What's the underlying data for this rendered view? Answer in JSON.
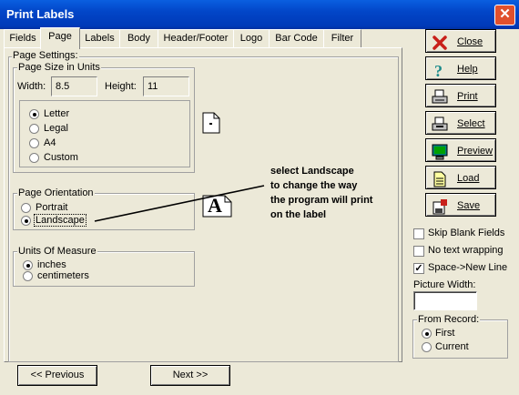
{
  "window": {
    "title": "Print Labels",
    "close_glyph": "✕"
  },
  "tabs": [
    "Fields",
    "Page",
    "Labels",
    "Body",
    "Header/Footer",
    "Logo",
    "Bar Code",
    "Filter"
  ],
  "page_settings": {
    "label": "Page Settings:",
    "size_group": {
      "label": "Page Size in Units",
      "width_label": "Width:",
      "width_value": "8.5",
      "height_label": "Height:",
      "height_value": "11",
      "options": [
        "Letter",
        "Legal",
        "A4",
        "Custom"
      ],
      "selected": "Letter"
    },
    "orientation_group": {
      "label": "Page Orientation",
      "options": [
        "Portrait",
        "Landscape"
      ],
      "selected": "Landscape"
    },
    "units_group": {
      "label": "Units Of Measure",
      "options": [
        "inches",
        "centimeters"
      ],
      "selected": "inches"
    },
    "orientation_icon_letter": "A"
  },
  "annotation": {
    "lines": [
      "select Landscape",
      "to change the way",
      "the program will print",
      "on the label"
    ]
  },
  "buttons": {
    "close": "Close",
    "help": "Help",
    "print": "Print",
    "select": "Select",
    "preview": "Preview",
    "load": "Load",
    "save": "Save"
  },
  "options": {
    "skip_blank": {
      "label": "Skip Blank Fields",
      "checked": false
    },
    "no_wrap": {
      "label": "No text wrapping",
      "checked": false
    },
    "space_newline": {
      "label": "Space->New Line",
      "checked": true
    },
    "picture_width_label": "Picture Width:",
    "picture_width_value": ""
  },
  "from_record": {
    "label": "From Record:",
    "options": [
      "First",
      "Current"
    ],
    "selected": "First"
  },
  "nav": {
    "previous": "<< Previous",
    "next": "Next >>"
  },
  "colors": {
    "title_bar": "#0246c8",
    "dialog_bg": "#ece9d8",
    "close_x": "#c8201a"
  }
}
